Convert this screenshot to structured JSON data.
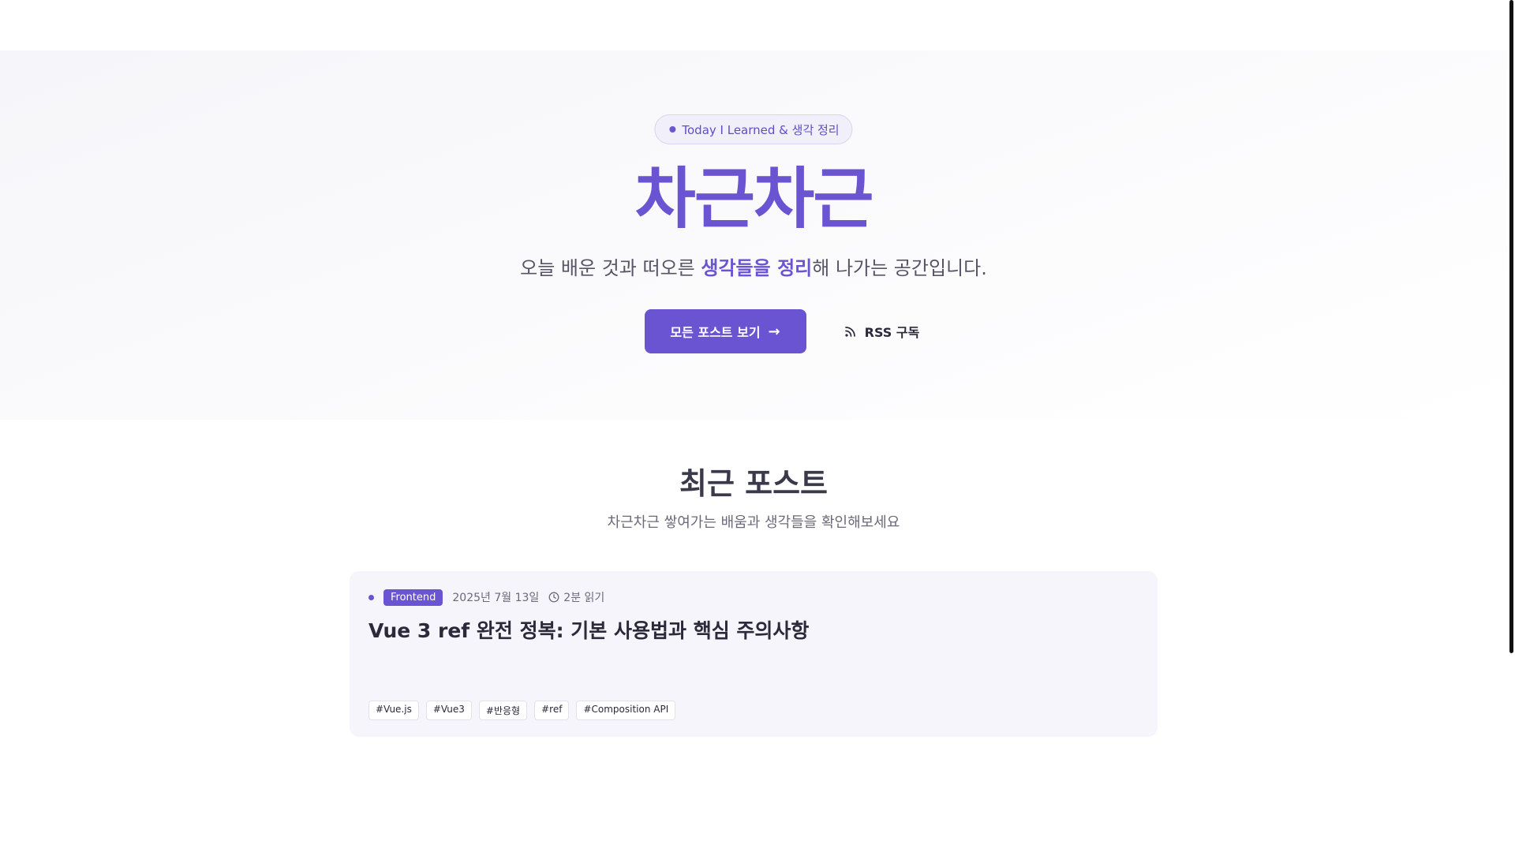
{
  "hero": {
    "badge": "Today I Learned & 생각 정리",
    "title": "차근차근",
    "subtitle_pre": "오늘 배운 것과 떠오른 ",
    "subtitle_highlight": "생각들을 정리",
    "subtitle_post": "해 나가는 공간입니다.",
    "primary_button": "모든 포스트 보기",
    "rss_button": "RSS 구독"
  },
  "section": {
    "title": "최근 포스트",
    "subtitle": "차근차근 쌓여가는 배움과 생각들을 확인해보세요"
  },
  "posts": [
    {
      "category": "Frontend",
      "date": "2025년 7월 13일",
      "read_time": "2분 읽기",
      "title": "Vue 3 ref 완전 정복: 기본 사용법과 핵심 주의사항",
      "tags": [
        "#Vue.js",
        "#Vue3",
        "#반응형",
        "#ref",
        "#Composition API"
      ]
    }
  ],
  "colors": {
    "accent": "#6a54d1",
    "card_bg": "#f6f5fb",
    "badge_bg": "#f1eff9"
  },
  "icons": {
    "badge_dot": "dot-icon",
    "primary_arrow": "arrow-right-icon",
    "rss": "rss-icon",
    "clock": "clock-icon"
  }
}
